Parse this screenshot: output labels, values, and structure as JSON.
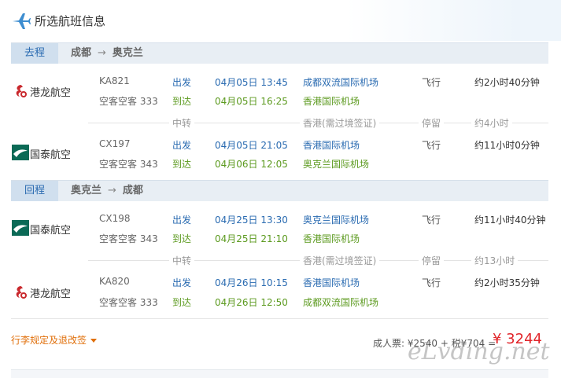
{
  "header": {
    "title": "所选航班信息"
  },
  "legs": [
    {
      "tag": "去程",
      "route_from": "成都",
      "route_to": "奥克兰",
      "segments": [
        {
          "airline": "港龙航空",
          "logo_icon": "dragonair-logo-icon",
          "flight_no": "KA821",
          "aircraft": "空客空客 333",
          "dep_label": "出发",
          "arr_label": "到达",
          "dep_time": "04月05日 13:45",
          "arr_time": "04月05日 16:25",
          "dep_airport": "成都双流国际机场",
          "arr_airport": "香港国际机场",
          "fly_label": "飞行",
          "duration": "约2小时40分钟"
        },
        {
          "airline": "国泰航空",
          "logo_icon": "cathay-logo-icon",
          "flight_no": "CX197",
          "aircraft": "空客空客 343",
          "dep_label": "出发",
          "arr_label": "到达",
          "dep_time": "04月05日 21:05",
          "arr_time": "04月06日 12:05",
          "dep_airport": "香港国际机场",
          "arr_airport": "奥克兰国际机场",
          "fly_label": "飞行",
          "duration": "约11小时0分钟"
        }
      ],
      "transfer": {
        "label": "中转",
        "city": "香港(需过境签证)",
        "stop_label": "停留",
        "stop_time": "约4小时"
      }
    },
    {
      "tag": "回程",
      "route_from": "奥克兰",
      "route_to": "成都",
      "segments": [
        {
          "airline": "国泰航空",
          "logo_icon": "cathay-logo-icon",
          "flight_no": "CX198",
          "aircraft": "空客空客 343",
          "dep_label": "出发",
          "arr_label": "到达",
          "dep_time": "04月25日 13:30",
          "arr_time": "04月25日 21:10",
          "dep_airport": "奥克兰国际机场",
          "arr_airport": "香港国际机场",
          "fly_label": "飞行",
          "duration": "约11小时40分钟"
        },
        {
          "airline": "港龙航空",
          "logo_icon": "dragonair-logo-icon",
          "flight_no": "KA820",
          "aircraft": "空客空客 333",
          "dep_label": "出发",
          "arr_label": "到达",
          "dep_time": "04月26日 10:15",
          "arr_time": "04月26日 12:50",
          "dep_airport": "香港国际机场",
          "arr_airport": "成都双流国际机场",
          "fly_label": "飞行",
          "duration": "约2小时35分钟"
        }
      ],
      "transfer": {
        "label": "中转",
        "city": "香港(需过境签证)",
        "stop_label": "停留",
        "stop_time": "约13小时"
      }
    }
  ],
  "footer": {
    "baggage_link": "行李规定及退改签",
    "price_breakdown": "成人票: ¥2540 + 税¥704 =",
    "price_total": "¥ 3244",
    "watermark": "eLvding.net"
  },
  "colors": {
    "accent_blue": "#2a6bb1",
    "arrive_green": "#5c9a1f",
    "price_red": "#e1252a",
    "link_orange": "#e06f0a"
  }
}
